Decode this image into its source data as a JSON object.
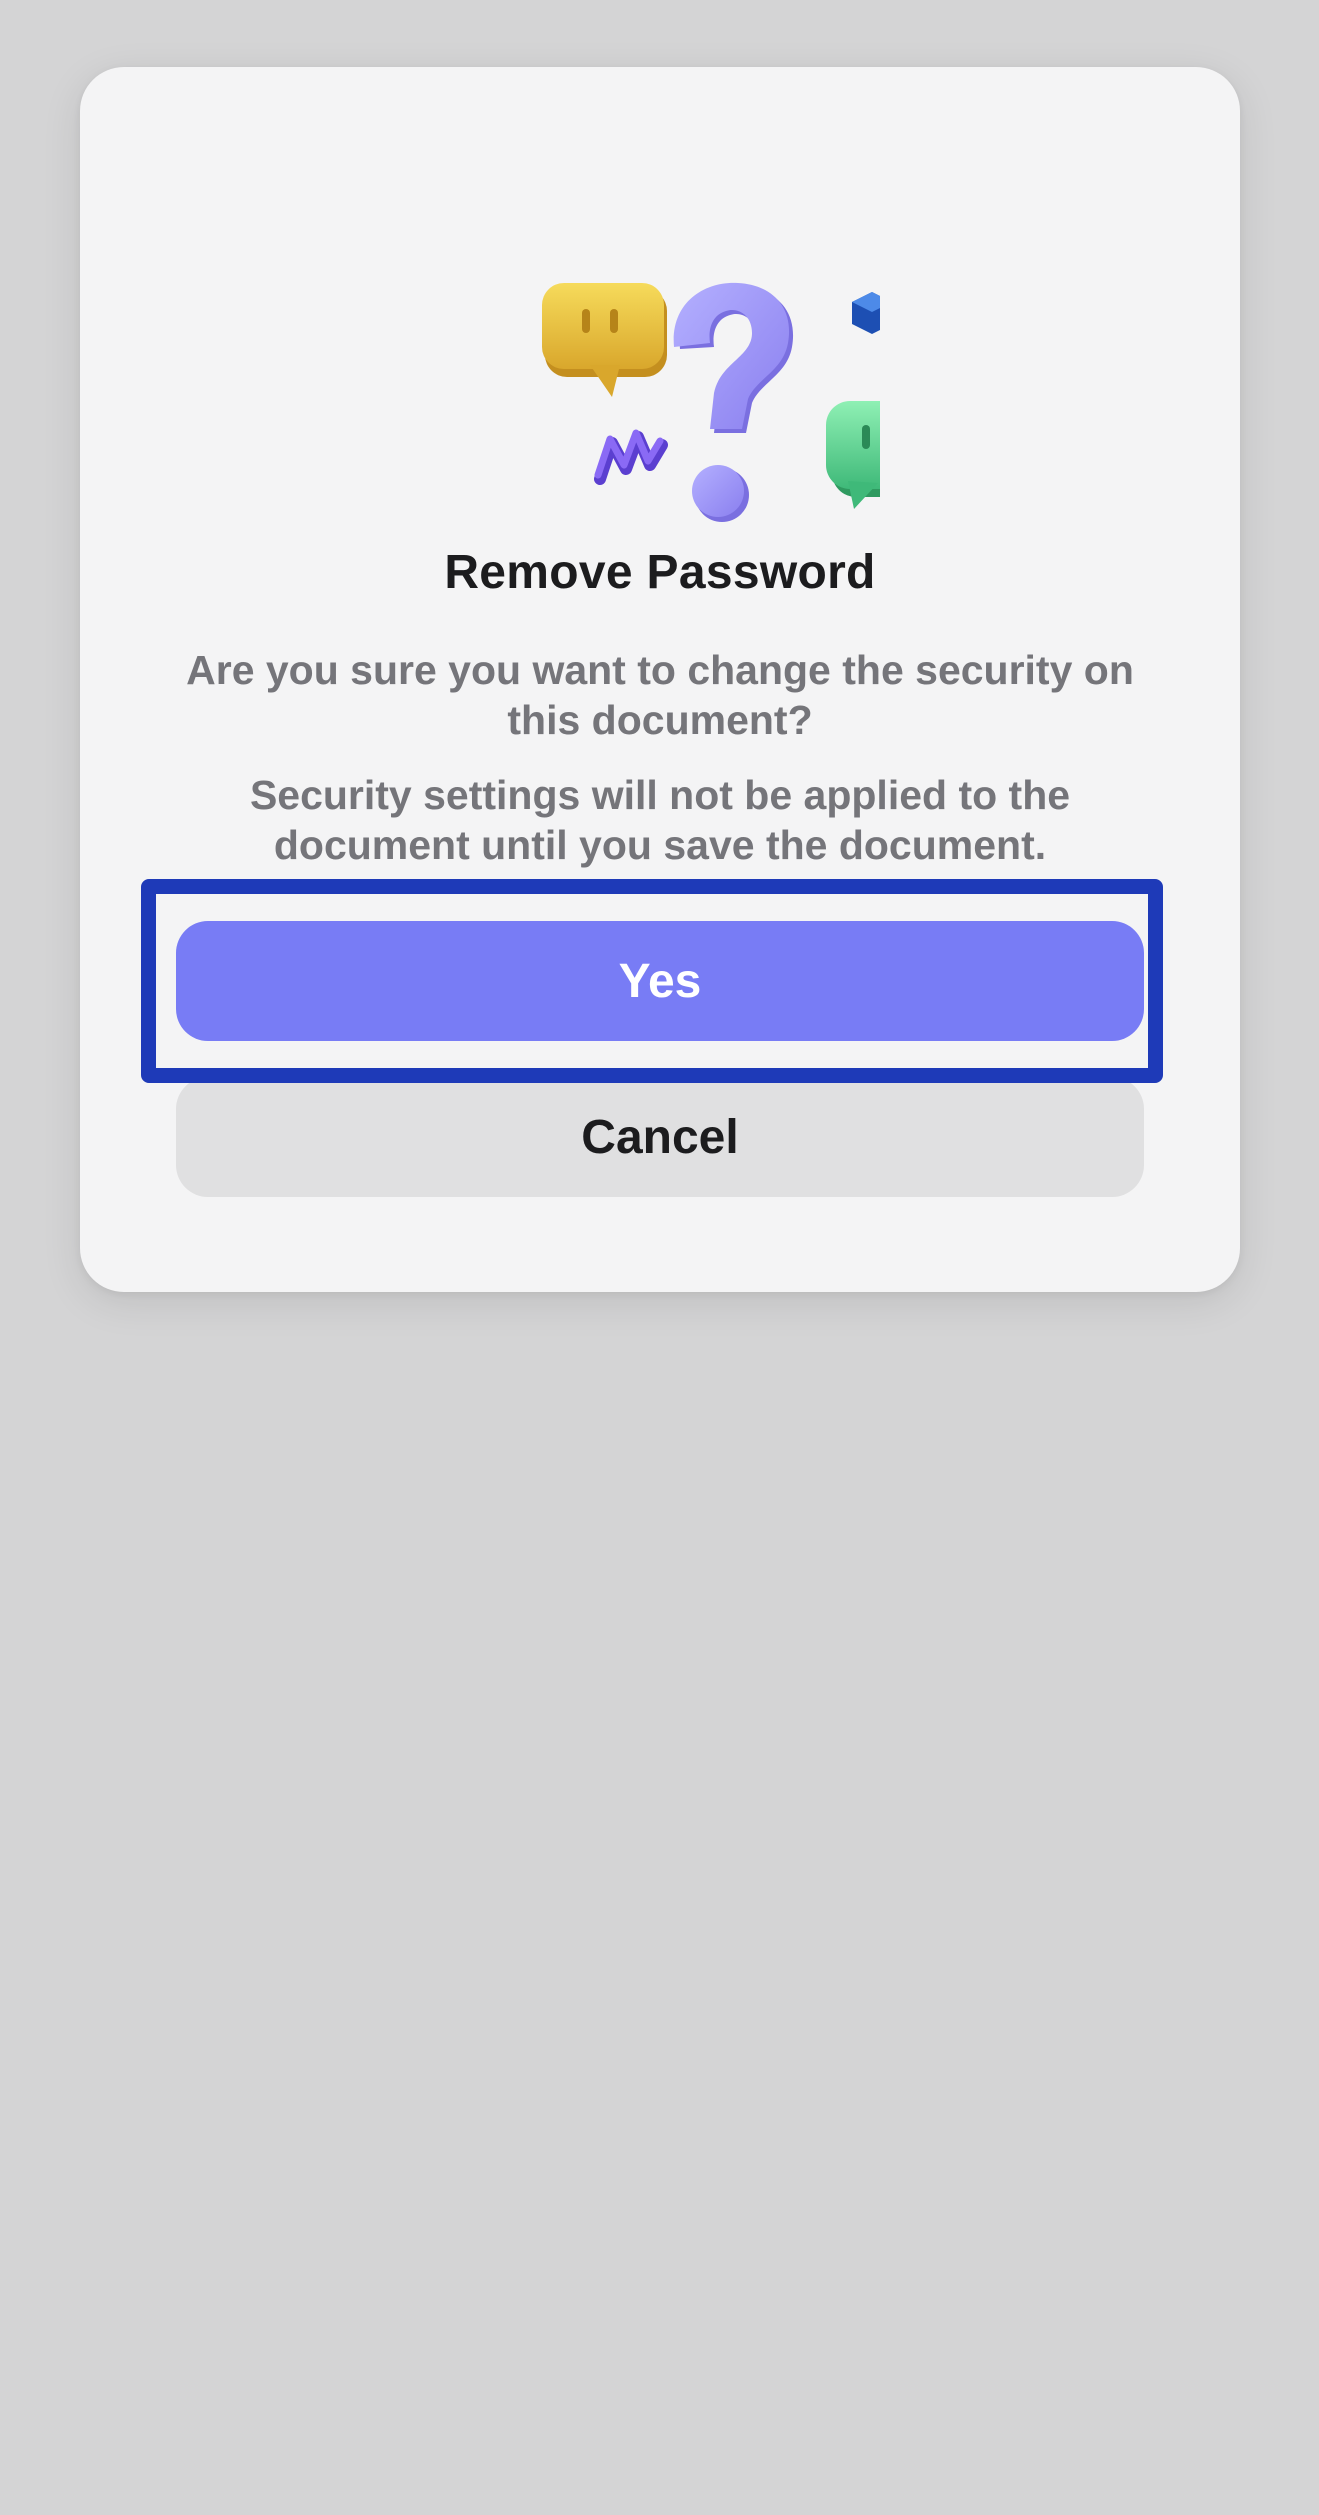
{
  "dialog": {
    "title": "Remove Password",
    "message_primary": "Are you sure you want to change the security on this document?",
    "message_secondary": "Security settings will not be applied to the document until you save the document.",
    "illustration_icon": "question-speech-bubbles-illustration"
  },
  "buttons": {
    "yes_label": "Yes",
    "cancel_label": "Cancel"
  },
  "colors": {
    "primary": "#787cf5",
    "secondary": "#e0e0e1",
    "backdrop": "#d4d4d5",
    "dialog_bg": "#f4f4f5",
    "highlight": "#1e3ab8"
  }
}
